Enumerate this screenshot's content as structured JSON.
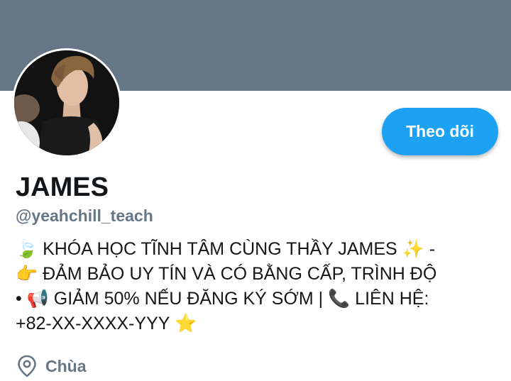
{
  "profile": {
    "display_name": "JAMES",
    "handle": "@yeahchill_teach",
    "bio": "🍃 KHÓA HỌC TĨNH TÂM CÙNG THẦY JAMES ✨ -\n👉 ĐẢM BẢO UY TÍN VÀ CÓ BẰNG CẤP, TRÌNH ĐỘ\n• 📢 GIẢM 50% NẾU ĐĂNG KÝ SỚM | 📞 LIÊN HỆ:\n+82-XX-XXXX-YYY ⭐",
    "location": "Chùa",
    "location_icon": "map-pin-icon",
    "avatar": "profile-photo"
  },
  "actions": {
    "follow_label": "Theo dõi"
  },
  "colors": {
    "banner": "#657786",
    "accent": "#1da1f2",
    "primary_text": "#14171a",
    "secondary_text": "#657786"
  }
}
